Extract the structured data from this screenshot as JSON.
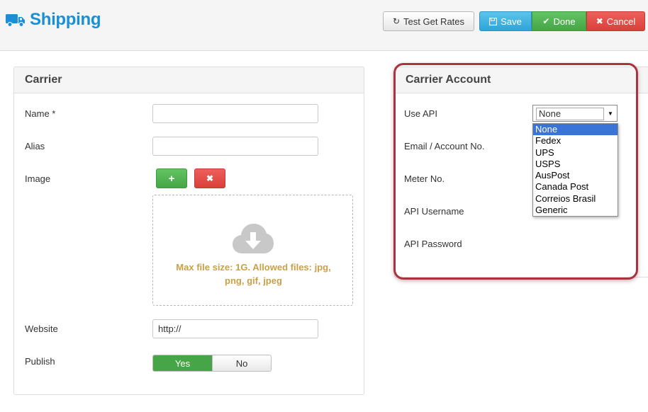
{
  "header": {
    "title": "Shipping",
    "title_icon": "truck-icon",
    "buttons": {
      "test_rates": "Test Get Rates",
      "save": "Save",
      "done": "Done",
      "cancel": "Cancel"
    }
  },
  "carrier": {
    "title": "Carrier",
    "fields": {
      "name_label": "Name *",
      "name_value": "",
      "alias_label": "Alias",
      "alias_value": "",
      "image_label": "Image",
      "dropzone_text": "Max file size: 1G. Allowed files: jpg, png, gif, jpeg",
      "website_label": "Website",
      "website_value": "http://",
      "publish_label": "Publish",
      "publish_yes": "Yes",
      "publish_no": "No",
      "publish_selected": "Yes"
    }
  },
  "carrier_account": {
    "title": "Carrier Account",
    "use_api_label": "Use API",
    "use_api_value": "None",
    "use_api_options": [
      "None",
      "Fedex",
      "UPS",
      "USPS",
      "AusPost",
      "Canada Post",
      "Correios Brasil",
      "Generic"
    ],
    "email_label": "Email / Account No.",
    "meter_label": "Meter No.",
    "username_label": "API Username",
    "password_label": "API Password"
  },
  "colors": {
    "title_blue": "#1a8fd5",
    "save_blue": "#2fa4d8",
    "success_green": "#46a546",
    "danger_red": "#d9403b",
    "dropzone_text": "#c8a046",
    "highlight_ring": "#a8343f",
    "option_selected": "#3a74d9"
  }
}
